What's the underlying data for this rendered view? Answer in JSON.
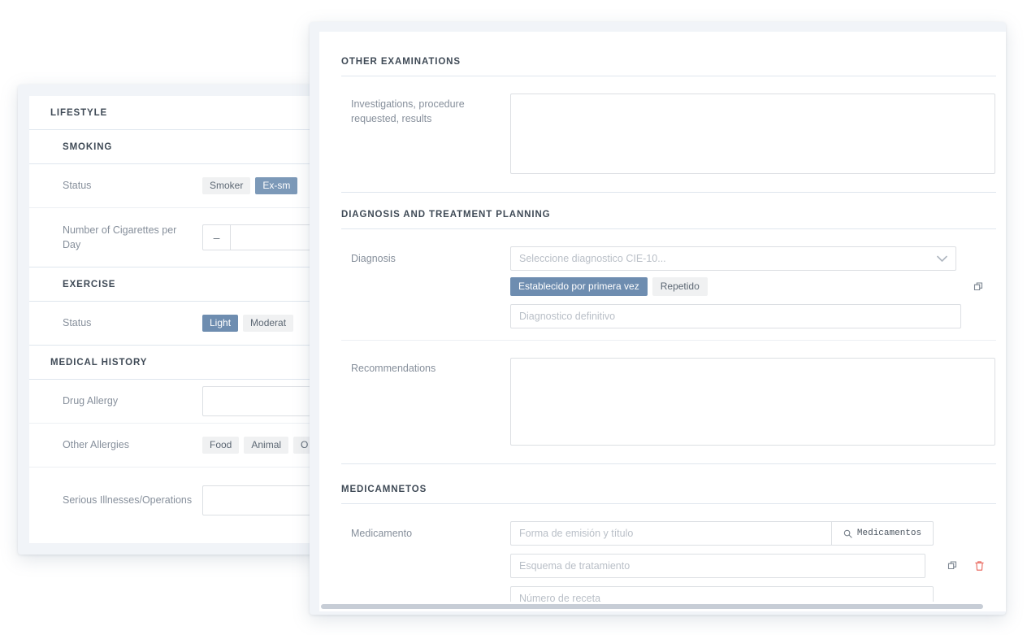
{
  "left_card": {
    "sections": [
      {
        "title": "LIFESTYLE",
        "level": 1,
        "subsections": [
          {
            "title": "SMOKING",
            "level": 2,
            "rows": [
              {
                "label": "Status",
                "type": "pills",
                "options": [
                  {
                    "label": "Smoker",
                    "selected": false
                  },
                  {
                    "label": "Ex-sm",
                    "selected": true
                  }
                ]
              },
              {
                "label": "Number of Cigarettes per Day",
                "type": "stepper",
                "minus_label": "–",
                "value": ""
              }
            ]
          },
          {
            "title": "EXERCISE",
            "level": 2,
            "rows": [
              {
                "label": "Status",
                "type": "pills",
                "options": [
                  {
                    "label": "Light",
                    "selected": true
                  },
                  {
                    "label": "Moderat",
                    "selected": false
                  }
                ]
              }
            ]
          }
        ]
      },
      {
        "title": "MEDICAL HISTORY",
        "level": 1,
        "subsections": [
          {
            "title": "",
            "level": 0,
            "rows": [
              {
                "label": "Drug Allergy",
                "type": "input",
                "value": ""
              },
              {
                "label": "Other Allergies",
                "type": "pills",
                "options": [
                  {
                    "label": "Food",
                    "selected": false
                  },
                  {
                    "label": "Animal",
                    "selected": false
                  },
                  {
                    "label": "O",
                    "selected": false
                  }
                ]
              },
              {
                "label": "Serious Illnesses/Operations",
                "type": "input",
                "value": ""
              }
            ]
          }
        ]
      }
    ]
  },
  "right_card": {
    "sections": {
      "other_examinations": {
        "title": "OTHER EXAMINATIONS",
        "rows": [
          {
            "label": "Investigations, procedure requested, results",
            "type": "textarea",
            "value": ""
          }
        ]
      },
      "diagnosis_treatment": {
        "title": "DIAGNOSIS AND TREATMENT PLANNING",
        "diagnosis_label": "Diagnosis",
        "diagnosis_select_placeholder": "Seleccione diagnostico CIE-10...",
        "diagnosis_pills": [
          {
            "label": "Establecido por primera vez",
            "selected": true
          },
          {
            "label": "Repetido",
            "selected": false
          }
        ],
        "definitive_placeholder": "Diagnostico definitivo",
        "copy_icon": "copy-icon",
        "recommendations_label": "Recommendations",
        "recommendations_value": ""
      },
      "medicamentos": {
        "title": "MEDICAMNETOS",
        "medicamento_label": "Medicamento",
        "forma_placeholder": "Forma de emisión y título",
        "search_button_label": "Medicamentos",
        "search_icon": "search-icon",
        "esquema_placeholder": "Esquema de tratamiento",
        "numero_placeholder": "Número de receta",
        "copy_icon": "copy-icon",
        "delete_icon": "trash-icon"
      }
    }
  },
  "colors": {
    "accent_selected_pill": "#7c99b8",
    "pill_bg": "#f0f1f2",
    "label_text": "#868f9b",
    "heading_text": "#3f4a56",
    "placeholder_text": "#b9bfc7",
    "divider": "#dfe6ee",
    "card_frame": "#f1f4f8",
    "delete_red": "#e8645a",
    "scrollbar_thumb": "#c7cdd6"
  }
}
